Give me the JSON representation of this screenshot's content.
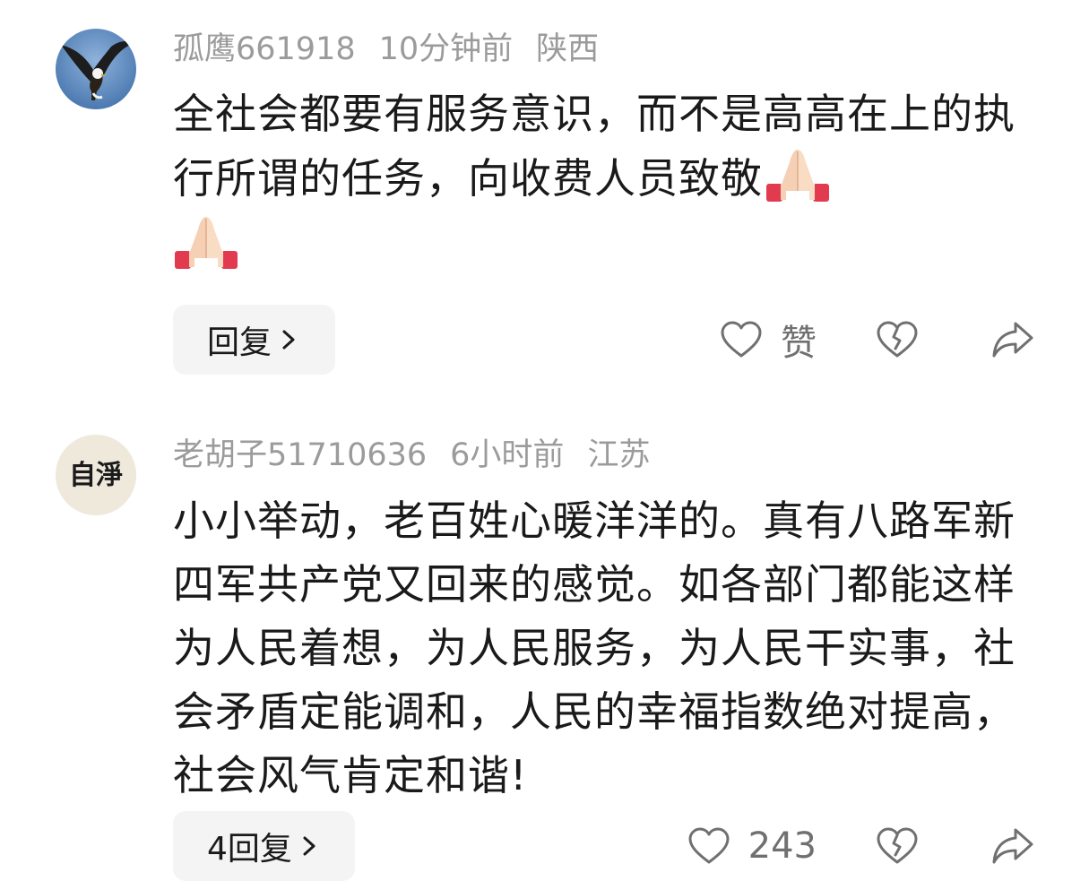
{
  "comments": [
    {
      "username": "孤鹰661918",
      "time": "10分钟前",
      "location": "陕西",
      "text": "全社会都要有服务意识，而不是高高在上的执行所谓的任务，向收费人员致敬",
      "emojis": [
        "praying-hands",
        "praying-hands"
      ],
      "reply_label": "回复",
      "like_label": "赞",
      "avatar": "eagle"
    },
    {
      "username": "老胡子51710636",
      "time": "6小时前",
      "location": "江苏",
      "text": "小小举动，老百姓心暖洋洋的。真有八路军新四军共产党又回来的感觉。如各部门都能这样为人民着想，为人民服务，为人民干实事，社会矛盾定能调和，人民的幸福指数绝对提高，社会风气肯定和谐!",
      "reply_label": "4回复",
      "like_count": "243",
      "avatar_text": "自淨"
    }
  ],
  "colors": {
    "meta": "#9b9b9b",
    "text": "#1a1a1a",
    "button_bg": "#f4f4f4",
    "icon": "#707070"
  }
}
